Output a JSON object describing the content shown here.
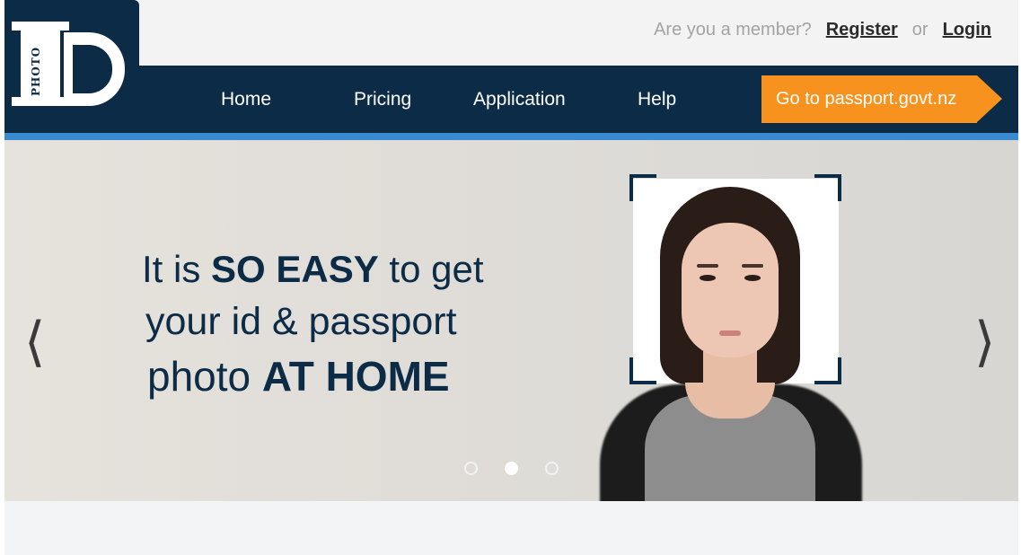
{
  "header": {
    "member_question": "Are you a member?",
    "register_label": "Register",
    "or_label": "or",
    "login_label": "Login"
  },
  "logo": {
    "letters": "ID",
    "sub_text": "PHOTO"
  },
  "nav": {
    "items": [
      {
        "label": "Home"
      },
      {
        "label": "Pricing"
      },
      {
        "label": "Application"
      },
      {
        "label": "Help"
      }
    ],
    "cta_label": "Go to passport.govt.nz"
  },
  "hero": {
    "line1_pre": "It is ",
    "line1_bold": "SO EASY",
    "line1_post": " to get",
    "line2": "your id & passport",
    "line3_pre": "photo ",
    "line3_bold": "AT HOME",
    "prev_arrow": "⟨",
    "next_arrow": "⟩",
    "slides": 3,
    "active_slide": 2
  },
  "colors": {
    "navy": "#0b2b47",
    "accent_blue": "#3a8ad1",
    "cta_orange": "#f7921e"
  }
}
